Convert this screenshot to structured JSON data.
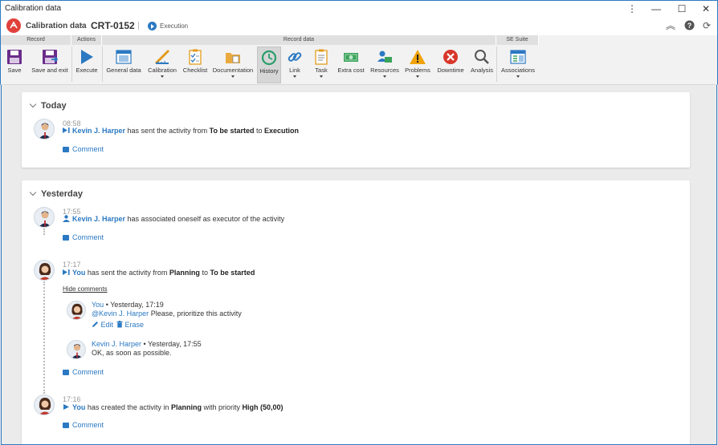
{
  "window": {
    "title": "Calibration data",
    "menu_icon": "more-vertical-icon"
  },
  "app": {
    "breadcrumb_parent": "Calibration data",
    "record_id": "CRT-0152",
    "status": "Execution"
  },
  "ribbon": {
    "groups": {
      "record": "Record",
      "actions": "Actions",
      "record_data": "Record data",
      "se_suite": "SE Suite"
    },
    "buttons": {
      "save": "Save",
      "save_exit": "Save and exit",
      "execute": "Execute",
      "general_data": "General data",
      "calibration": "Calibration",
      "checklist": "Checklist",
      "documentation": "Documentation",
      "history": "History",
      "link": "Link",
      "task": "Task",
      "extra_cost": "Extra cost",
      "resources": "Resources",
      "problems": "Problems",
      "downtime": "Downtime",
      "analysis": "Analysis",
      "associations": "Associations"
    }
  },
  "today": {
    "heading": "Today",
    "entries": [
      {
        "time": "08:58",
        "user": "Kevin J. Harper",
        "t1": "has sent the activity from",
        "from": "To be started",
        "t2": "to",
        "to": "Execution",
        "comment": "Comment"
      }
    ]
  },
  "yesterday": {
    "heading": "Yesterday",
    "entries": [
      {
        "time": "17:55",
        "user": "Kevin J. Harper",
        "t1": "has associated oneself as executor of the activity",
        "comment": "Comment"
      },
      {
        "time": "17:17",
        "user": "You",
        "t1": "has sent the activity from",
        "from": "Planning",
        "t2": "to",
        "to": "To be started",
        "hide_comments": "Hide comments",
        "comments": [
          {
            "author": "You",
            "bullet": "•",
            "when": "Yesterday, 17:19",
            "mention": "@Kevin J. Harper",
            "text": "Please, prioritize this activity",
            "edit": "Edit",
            "erase": "Erase"
          },
          {
            "author": "Kevin J. Harper",
            "bullet": "•",
            "when": "Yesterday, 17:55",
            "text": "OK, as soon as possible."
          }
        ],
        "comment": "Comment"
      },
      {
        "time": "17:16",
        "user": "You",
        "t1": "has created the activity in",
        "state": "Planning",
        "t2": "with priority",
        "priority": "High (50,00)",
        "comment": "Comment"
      }
    ]
  }
}
